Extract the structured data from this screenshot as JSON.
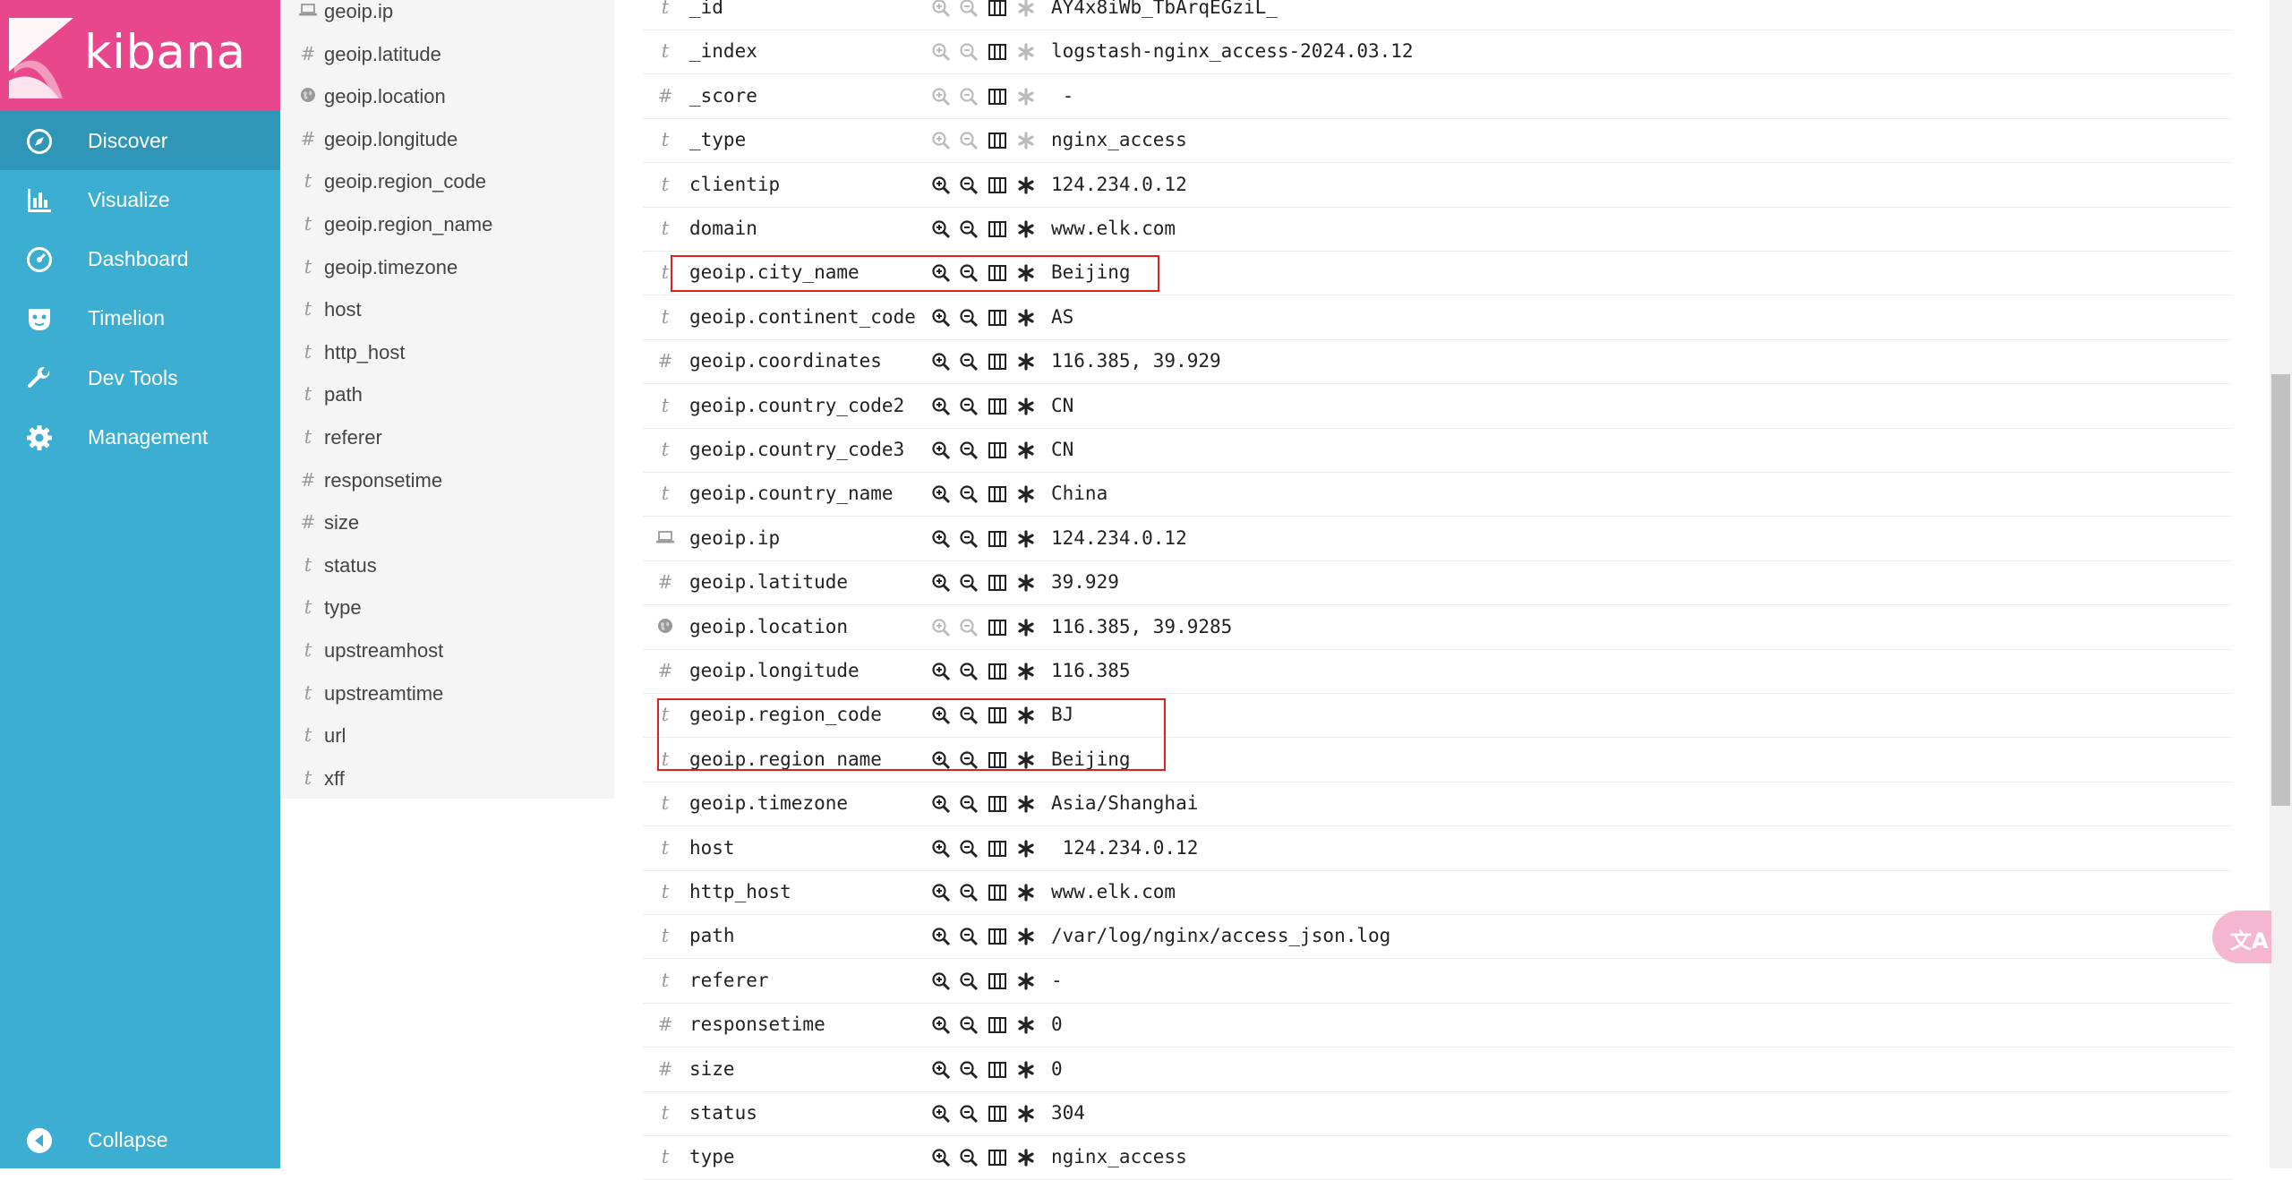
{
  "app": {
    "brand": "kibana",
    "brand_color": "#e8488b",
    "nav_color": "#3caed2",
    "nav_active_color": "#2f96b7"
  },
  "nav": {
    "items": [
      {
        "label": "Discover",
        "icon": "compass-icon",
        "active": true
      },
      {
        "label": "Visualize",
        "icon": "bar-chart-icon",
        "active": false
      },
      {
        "label": "Dashboard",
        "icon": "dashboard-gauge-icon",
        "active": false
      },
      {
        "label": "Timelion",
        "icon": "timelion-mask-icon",
        "active": false
      },
      {
        "label": "Dev Tools",
        "icon": "wrench-icon",
        "active": false
      },
      {
        "label": "Management",
        "icon": "gear-icon",
        "active": false
      }
    ],
    "collapse_label": "Collapse"
  },
  "field_list": [
    {
      "type": "ip",
      "type_label": "",
      "name": "geoip.ip"
    },
    {
      "type": "number",
      "type_label": "#",
      "name": "geoip.latitude"
    },
    {
      "type": "geo",
      "type_label": "",
      "name": "geoip.location"
    },
    {
      "type": "number",
      "type_label": "#",
      "name": "geoip.longitude"
    },
    {
      "type": "string",
      "type_label": "t",
      "name": "geoip.region_code"
    },
    {
      "type": "string",
      "type_label": "t",
      "name": "geoip.region_name"
    },
    {
      "type": "string",
      "type_label": "t",
      "name": "geoip.timezone"
    },
    {
      "type": "string",
      "type_label": "t",
      "name": "host"
    },
    {
      "type": "string",
      "type_label": "t",
      "name": "http_host"
    },
    {
      "type": "string",
      "type_label": "t",
      "name": "path"
    },
    {
      "type": "string",
      "type_label": "t",
      "name": "referer"
    },
    {
      "type": "number",
      "type_label": "#",
      "name": "responsetime"
    },
    {
      "type": "number",
      "type_label": "#",
      "name": "size"
    },
    {
      "type": "string",
      "type_label": "t",
      "name": "status"
    },
    {
      "type": "string",
      "type_label": "t",
      "name": "type"
    },
    {
      "type": "string",
      "type_label": "t",
      "name": "upstreamhost"
    },
    {
      "type": "string",
      "type_label": "t",
      "name": "upstreamtime"
    },
    {
      "type": "string",
      "type_label": "t",
      "name": "url"
    },
    {
      "type": "string",
      "type_label": "t",
      "name": "xff"
    }
  ],
  "doc_rows": [
    {
      "type": "string",
      "type_label": "t",
      "field": "_id",
      "value": "AY4x8iWb_TbArqEGziL_",
      "actions_enabled": false
    },
    {
      "type": "string",
      "type_label": "t",
      "field": "_index",
      "value": "logstash-nginx_access-2024.03.12",
      "actions_enabled": false
    },
    {
      "type": "number",
      "type_label": "#",
      "field": "_score",
      "value": " -",
      "actions_enabled": false
    },
    {
      "type": "string",
      "type_label": "t",
      "field": "_type",
      "value": "nginx_access",
      "actions_enabled": false
    },
    {
      "type": "string",
      "type_label": "t",
      "field": "clientip",
      "value": "124.234.0.12",
      "actions_enabled": true
    },
    {
      "type": "string",
      "type_label": "t",
      "field": "domain",
      "value": "www.elk.com",
      "actions_enabled": true
    },
    {
      "type": "string",
      "type_label": "t",
      "field": "geoip.city_name",
      "value": "Beijing",
      "actions_enabled": true
    },
    {
      "type": "string",
      "type_label": "t",
      "field": "geoip.continent_code",
      "value": "AS",
      "actions_enabled": true
    },
    {
      "type": "number",
      "type_label": "#",
      "field": "geoip.coordinates",
      "value": "116.385, 39.929",
      "actions_enabled": true
    },
    {
      "type": "string",
      "type_label": "t",
      "field": "geoip.country_code2",
      "value": "CN",
      "actions_enabled": true
    },
    {
      "type": "string",
      "type_label": "t",
      "field": "geoip.country_code3",
      "value": "CN",
      "actions_enabled": true
    },
    {
      "type": "string",
      "type_label": "t",
      "field": "geoip.country_name",
      "value": "China",
      "actions_enabled": true
    },
    {
      "type": "ip",
      "type_label": "",
      "field": "geoip.ip",
      "value": "124.234.0.12",
      "actions_enabled": true
    },
    {
      "type": "number",
      "type_label": "#",
      "field": "geoip.latitude",
      "value": "39.929",
      "actions_enabled": true
    },
    {
      "type": "geo",
      "type_label": "",
      "field": "geoip.location",
      "value": "116.385, 39.9285",
      "actions_enabled": "partial"
    },
    {
      "type": "number",
      "type_label": "#",
      "field": "geoip.longitude",
      "value": "116.385",
      "actions_enabled": true
    },
    {
      "type": "string",
      "type_label": "t",
      "field": "geoip.region_code",
      "value": "BJ",
      "actions_enabled": true
    },
    {
      "type": "string",
      "type_label": "t",
      "field": "geoip.region_name",
      "value": "Beijing",
      "actions_enabled": true
    },
    {
      "type": "string",
      "type_label": "t",
      "field": "geoip.timezone",
      "value": "Asia/Shanghai",
      "actions_enabled": true
    },
    {
      "type": "string",
      "type_label": "t",
      "field": "host",
      "value": " 124.234.0.12",
      "actions_enabled": true
    },
    {
      "type": "string",
      "type_label": "t",
      "field": "http_host",
      "value": "www.elk.com",
      "actions_enabled": true
    },
    {
      "type": "string",
      "type_label": "t",
      "field": "path",
      "value": "/var/log/nginx/access_json.log",
      "actions_enabled": true
    },
    {
      "type": "string",
      "type_label": "t",
      "field": "referer",
      "value": "-",
      "actions_enabled": true
    },
    {
      "type": "number",
      "type_label": "#",
      "field": "responsetime",
      "value": "0",
      "actions_enabled": true
    },
    {
      "type": "number",
      "type_label": "#",
      "field": "size",
      "value": "0",
      "actions_enabled": true
    },
    {
      "type": "string",
      "type_label": "t",
      "field": "status",
      "value": "304",
      "actions_enabled": true
    },
    {
      "type": "string",
      "type_label": "t",
      "field": "type",
      "value": "nginx_access",
      "actions_enabled": true
    }
  ],
  "row_actions": [
    "filter-for-value-icon",
    "filter-out-value-icon",
    "toggle-column-icon",
    "filter-exists-icon"
  ],
  "highlight_color": "#e02020",
  "translate_fab": {
    "icon": "translate-icon",
    "glyph": "文A"
  }
}
